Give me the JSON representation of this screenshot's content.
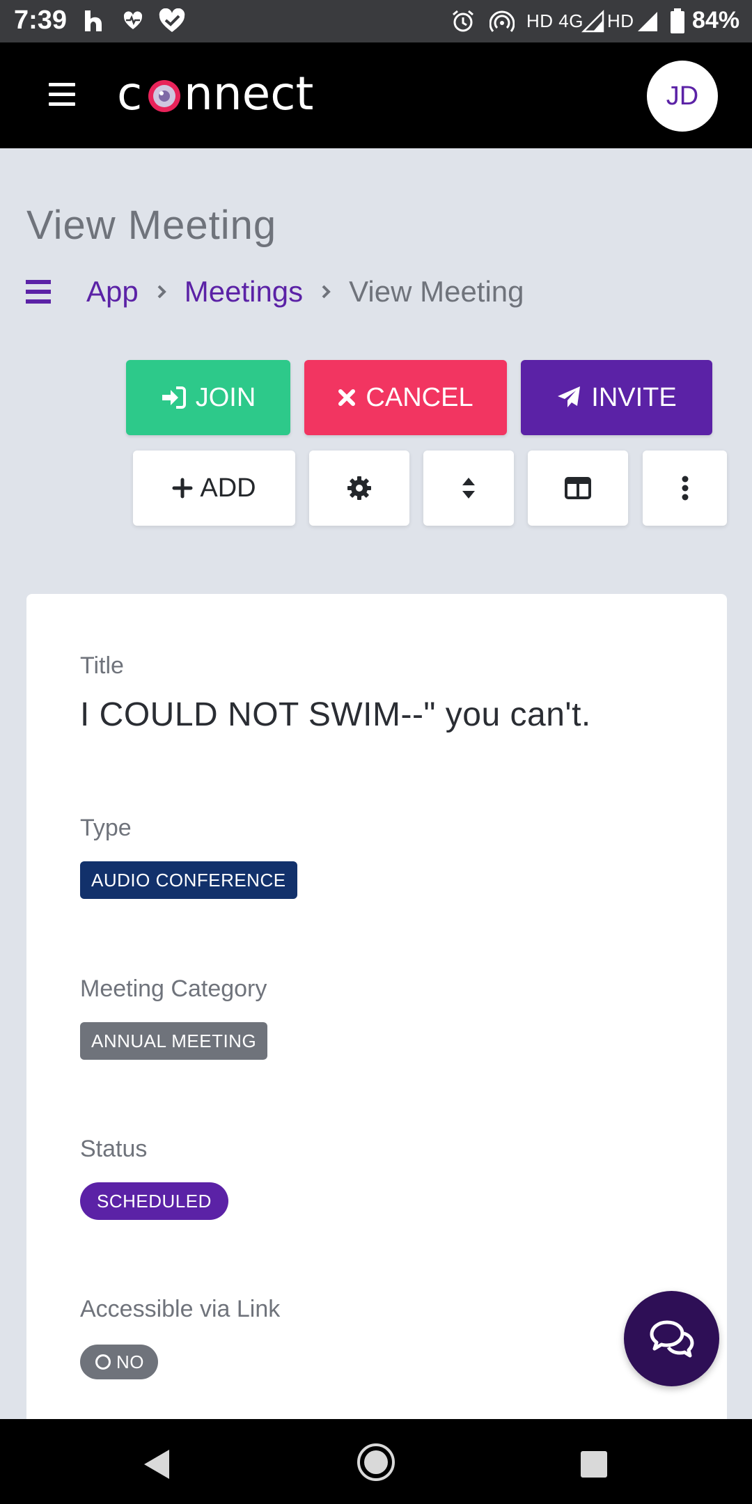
{
  "status_bar": {
    "time": "7:39",
    "network": "HD 4G",
    "network2": "HD",
    "battery": "84%",
    "icons": [
      "home-app-icon",
      "heart-rate-icon",
      "health-icon",
      "alarm-icon",
      "hotspot-icon",
      "signal-icon",
      "battery-icon"
    ]
  },
  "top_bar": {
    "logo_text": "connect",
    "avatar_initials": "JD",
    "menu_icon": "hamburger-icon"
  },
  "page": {
    "title": "View Meeting"
  },
  "breadcrumb": {
    "items": [
      "App",
      "Meetings",
      "View Meeting"
    ]
  },
  "actions": {
    "join": "JOIN",
    "cancel": "CANCEL",
    "invite": "INVITE",
    "add": "ADD",
    "icons": [
      "settings-icon",
      "sort-icon",
      "layout-icon",
      "more-icon"
    ]
  },
  "meeting": {
    "title_label": "Title",
    "title_value": "I COULD NOT SWIM--\" you can't.",
    "type_label": "Type",
    "type_value": "AUDIO CONFERENCE",
    "category_label": "Meeting Category",
    "category_value": "ANNUAL MEETING",
    "status_label": "Status",
    "status_value": "SCHEDULED",
    "link_label": "Accessible via Link",
    "link_value": "NO"
  },
  "colors": {
    "brand_purple": "#5b22a6",
    "join_green": "#2dc98a",
    "cancel_red": "#f23561",
    "type_badge": "#12316b",
    "gray_badge": "#6f737b",
    "fab": "#2e0f56"
  }
}
